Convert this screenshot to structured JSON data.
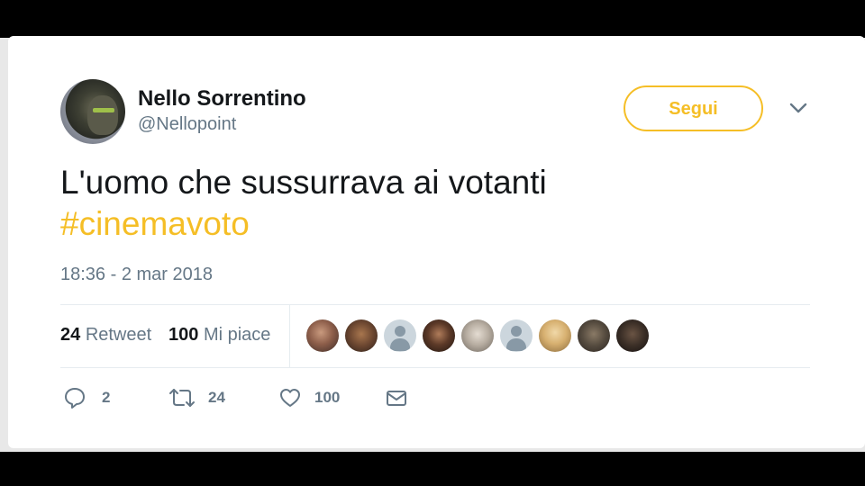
{
  "tweet": {
    "author_name": "Nello Sorrentino",
    "author_handle": "@Nellopoint",
    "follow_label": "Segui",
    "text": "L'uomo che sussurrava ai votanti",
    "hashtag": "#cinemavoto",
    "timestamp": "18:36 - 2 mar 2018"
  },
  "stats": {
    "retweets_count": "24",
    "retweets_label": "Retweet",
    "likes_count": "100",
    "likes_label": "Mi piace"
  },
  "liker_avatars": [
    "photo",
    "photo",
    "default",
    "photo",
    "photo",
    "default",
    "photo",
    "photo",
    "photo"
  ],
  "actions": {
    "reply_count": "2",
    "retweet_count": "24",
    "like_count": "100"
  },
  "colors": {
    "accent": "#f5be26",
    "text": "#14171a",
    "muted": "#657786"
  },
  "icons": [
    "chevron-down-icon",
    "reply-icon",
    "retweet-icon",
    "heart-icon",
    "message-icon"
  ]
}
